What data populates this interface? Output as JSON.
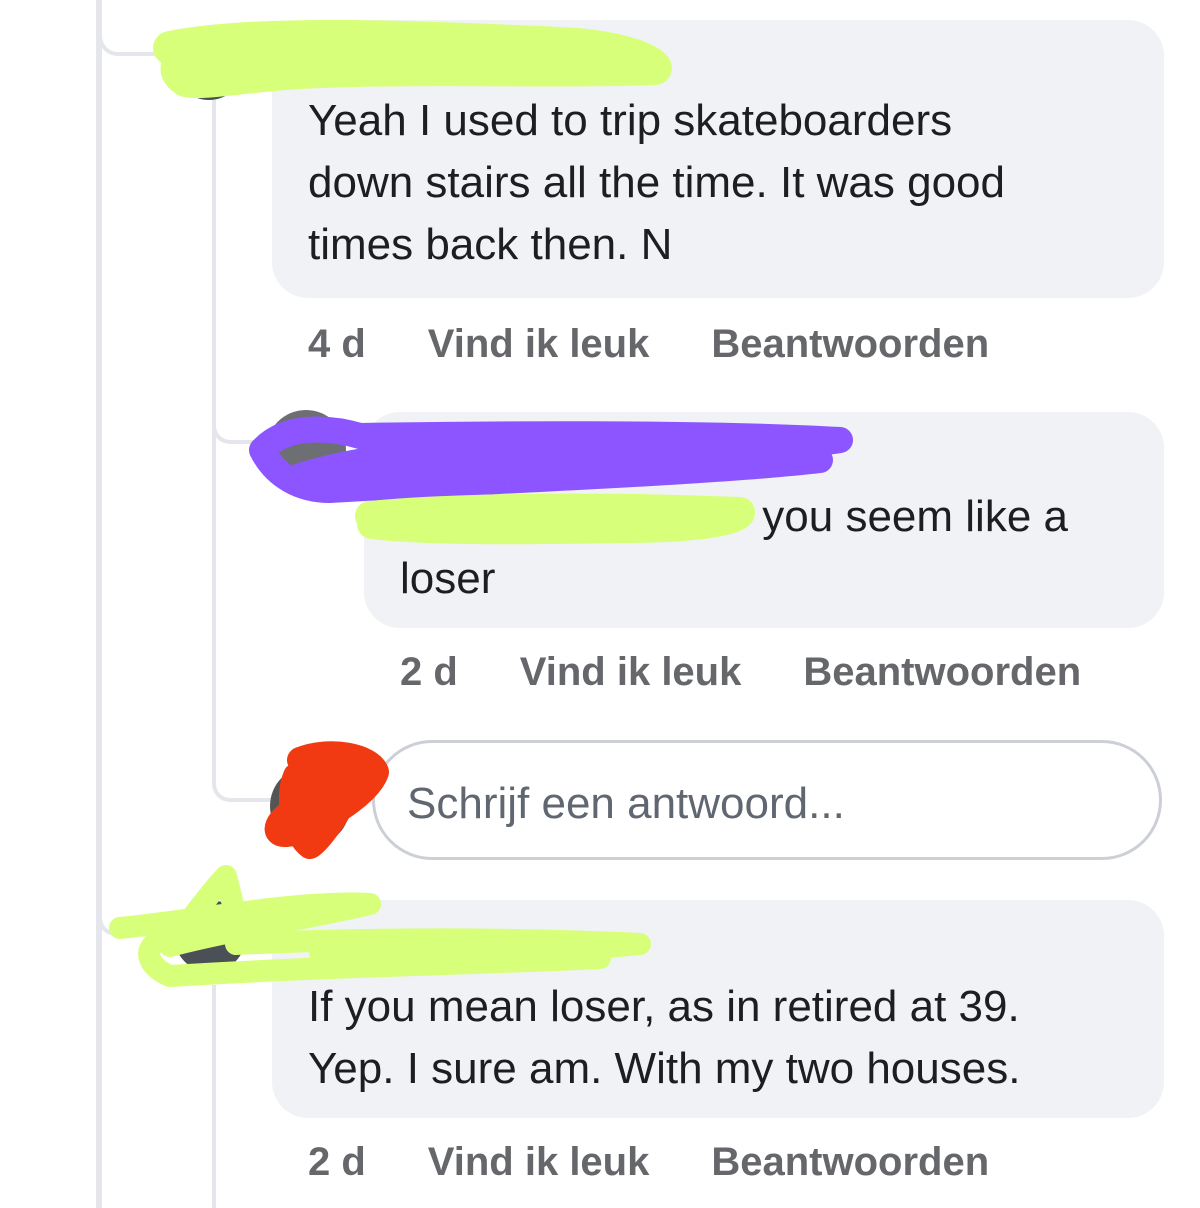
{
  "comments": [
    {
      "author_redacted": true,
      "text_lines": [
        "Yeah I used to trip skateboarders",
        "down stairs all the time.  It was good",
        "times back then. N"
      ],
      "time": "4 d",
      "like_label": "Vind ik leuk",
      "reply_label": "Beantwoorden"
    },
    {
      "author_redacted": true,
      "text_line1": "you seem like a",
      "text_line2": "loser",
      "time": "2 d",
      "like_label": "Vind ik leuk",
      "reply_label": "Beantwoorden"
    },
    {
      "author_redacted": true,
      "text_lines": [
        "If you mean loser, as in retired at 39.",
        "Yep.  I sure am.  With my two houses."
      ],
      "time": "2 d",
      "like_label": "Vind ik leuk",
      "reply_label": "Beantwoorden"
    }
  ],
  "reply_box": {
    "placeholder": "Schrijf een antwoord..."
  },
  "colors": {
    "bubble": "#f0f2f5",
    "muted_text": "#65676b",
    "redaction_green": "#d8ff7a",
    "redaction_purple": "#8c55ff",
    "redaction_red": "#f23a12"
  }
}
